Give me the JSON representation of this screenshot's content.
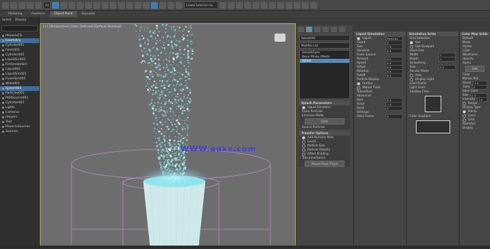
{
  "toolbar": {
    "field_left": "All",
    "field_right": "Create Selection Se"
  },
  "tabs": [
    {
      "label": "Modeling",
      "active": false
    },
    {
      "label": "Freeform",
      "active": false
    },
    {
      "label": "Object Paint",
      "active": true
    },
    {
      "label": "Populate",
      "active": false
    }
  ],
  "scene_explorer": {
    "header_left": "Select",
    "header_right": "Display",
    "items": [
      {
        "label": "PhoenixFD",
        "selected": false
      },
      {
        "label": "Geometry",
        "selected": true
      },
      {
        "label": "Cylinder001",
        "selected": false
      },
      {
        "label": "Foam001",
        "selected": false
      },
      {
        "label": "Cylinder002",
        "selected": false
      },
      {
        "label": "LiquidSrc001",
        "selected": false
      },
      {
        "label": "FireSmokeSim",
        "selected": false
      },
      {
        "label": "Liquid001",
        "selected": false
      },
      {
        "label": "LiquidSim001",
        "selected": false
      },
      {
        "label": "FoamSim001",
        "selected": false
      },
      {
        "label": "Wake001",
        "selected": false
      },
      {
        "label": "Splash001",
        "selected": true
      },
      {
        "label": "Particles001",
        "selected": false
      },
      {
        "label": "PHXSource001",
        "selected": false
      },
      {
        "label": "Cylinder003",
        "selected": false
      },
      {
        "label": "Lights",
        "selected": false
      },
      {
        "label": "Cameras",
        "selected": false
      },
      {
        "label": "Helpers",
        "selected": false
      },
      {
        "label": "Text",
        "selected": false
      },
      {
        "label": "PhoenixSources",
        "selected": false
      },
      {
        "label": "Sources",
        "selected": false
      }
    ]
  },
  "viewport": {
    "label": "[+] [Perspective] [User Defined] [Default Shading]",
    "watermark": "WWW.aaxx.com"
  },
  "command_panel": {
    "object_name": "Splash001",
    "modifier_list_label": "Modifier List",
    "modifiers": [
      {
        "label": "SmoothOpen",
        "selected": false
      },
      {
        "label": "Noise Mtrsky (Mesh)",
        "selected": false
      },
      {
        "label": "Splash",
        "selected": true
      }
    ],
    "rollouts": [
      {
        "title": "Splash Parameters",
        "rows": [
          {
            "type": "radio",
            "label": "Liquid Simulator",
            "on": true
          },
          {
            "type": "text",
            "label": "Foam Particles"
          },
          {
            "type": "text",
            "label": "Emission Mode"
          },
          {
            "type": "button",
            "label": "Emit"
          },
          {
            "type": "text",
            "label": "Source Particles"
          }
        ]
      },
      {
        "title": "Transfer Options",
        "rows": [
          {
            "type": "radio",
            "label": "Add Particles Rate",
            "on": true
          },
          {
            "type": "radio",
            "label": "Count",
            "on": false
          },
          {
            "type": "radio",
            "label": "Particle Size",
            "on": false
          },
          {
            "type": "radio",
            "label": "Particle Velocity",
            "on": false
          },
          {
            "type": "radio",
            "label": "Affect Shading",
            "on": false
          },
          {
            "type": "text",
            "label": "Tree Inheritance"
          },
          {
            "type": "button",
            "label": "Attach Foam Foam"
          }
        ]
      }
    ]
  },
  "panels": [
    {
      "title": "Liquid Simulation",
      "rows": [
        {
          "type": "radio",
          "label": "Liquid",
          "on": true,
          "value": "Particles"
        },
        {
          "type": "spin",
          "label": "Count",
          "value": "0"
        },
        {
          "type": "spin",
          "label": "Size",
          "value": "1.0"
        },
        {
          "type": "spin",
          "label": "Variation",
          "value": "0.0"
        },
        {
          "type": "text",
          "label": "Foam Source"
        },
        {
          "type": "spin",
          "label": "Amount",
          "value": "0.1"
        },
        {
          "type": "spin",
          "label": "Speed",
          "value": "0.0"
        },
        {
          "type": "spin",
          "label": "Offset",
          "value": "0.0"
        },
        {
          "type": "spin",
          "label": "Rotation",
          "value": "0.0"
        },
        {
          "type": "spin",
          "label": "Falloff",
          "value": "0.0"
        },
        {
          "type": "text",
          "label": "Particle Display"
        },
        {
          "type": "radio",
          "label": "Outline",
          "on": true
        },
        {
          "type": "radio",
          "label": "Motion Trails",
          "on": false
        },
        {
          "type": "text",
          "label": "Tubes/Rain"
        },
        {
          "type": "text",
          "label": "Advanced"
        },
        {
          "type": "spin",
          "label": "Bias",
          "value": "0.0"
        },
        {
          "type": "spin",
          "label": "Scale",
          "value": "1.0"
        },
        {
          "type": "spin",
          "label": "Seed",
          "value": "0"
        },
        {
          "type": "text",
          "label": "Settings"
        },
        {
          "type": "spin",
          "label": "Start Frame",
          "value": "0"
        }
      ]
    },
    {
      "title": "Simulation Grids",
      "rows": [
        {
          "type": "text",
          "label": "Grid Selection"
        },
        {
          "type": "radio",
          "label": "Use",
          "on": true
        },
        {
          "type": "radio",
          "label": "Use Viewport",
          "on": false
        },
        {
          "type": "text",
          "label": "Voxel Size"
        },
        {
          "type": "spin",
          "label": "Width",
          "value": "1"
        },
        {
          "type": "spin",
          "label": "Depth",
          "value": "1"
        },
        {
          "type": "text",
          "label": "Smoothing"
        },
        {
          "type": "spin",
          "label": "Size",
          "value": "0.0"
        },
        {
          "type": "text",
          "label": "Render Mode"
        },
        {
          "type": "radio",
          "label": "Auto",
          "on": false
        },
        {
          "type": "radio",
          "label": "Display Light",
          "on": false
        },
        {
          "type": "text",
          "label": "Load Profile"
        },
        {
          "type": "text",
          "label": "Light Grain"
        },
        {
          "type": "text",
          "label": "Shadow Color"
        },
        {
          "type": "preview",
          "label": ""
        },
        {
          "type": "text",
          "label": "Color Gradient"
        },
        {
          "type": "preview_wide",
          "label": ""
        }
      ]
    },
    {
      "title": "Color Map Grids",
      "rows": [
        {
          "type": "text",
          "label": "Default"
        },
        {
          "type": "text",
          "label": "Mode"
        },
        {
          "type": "text",
          "label": "Vertex"
        },
        {
          "type": "text",
          "label": "Color"
        },
        {
          "type": "text",
          "label": "Wireframe"
        },
        {
          "type": "text",
          "label": "Opacity"
        },
        {
          "type": "text",
          "label": "Alpha"
        },
        {
          "type": "button",
          "label": "Edit"
        },
        {
          "type": "text",
          "label": "Color"
        },
        {
          "type": "text",
          "label": "Motion Blur"
        },
        {
          "type": "spin",
          "label": "Sharp",
          "value": "1.0"
        },
        {
          "type": "spin",
          "label": "Trails",
          "value": "0"
        },
        {
          "type": "text",
          "label": "Bake Color"
        },
        {
          "type": "spin",
          "label": "Size",
          "value": "1.0"
        },
        {
          "type": "spin",
          "label": "Intensity",
          "value": "1.0"
        },
        {
          "type": "radio",
          "label": "Range",
          "on": false
        },
        {
          "type": "text",
          "label": "Display Type"
        },
        {
          "type": "radio",
          "label": "Points",
          "on": true
        },
        {
          "type": "radio",
          "label": "Lines",
          "on": false
        },
        {
          "type": "radio",
          "label": "Grid",
          "on": false
        },
        {
          "type": "text",
          "label": "Statistics"
        },
        {
          "type": "text",
          "label": "Display"
        }
      ]
    }
  ],
  "colors": {
    "accent": "#3e6f9e",
    "viewport_bg": "#6d6d6d",
    "particles": "#6fd3e0",
    "viewport_border": "#c8a43a"
  }
}
